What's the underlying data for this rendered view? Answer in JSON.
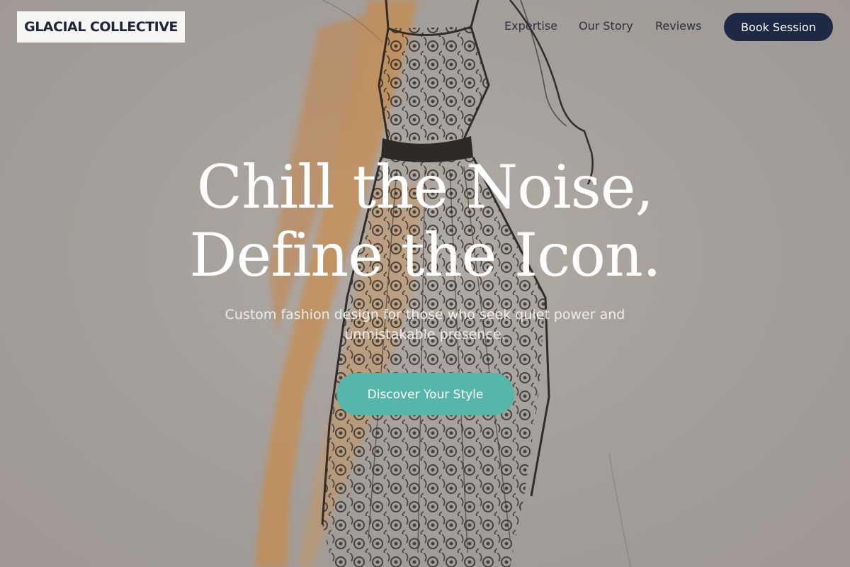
{
  "brand": {
    "name": "GLACIAL COLLECTIVE"
  },
  "nav": {
    "links": [
      {
        "label": "Expertise"
      },
      {
        "label": "Our Story"
      },
      {
        "label": "Reviews"
      }
    ],
    "cta_label": "Book Session"
  },
  "hero": {
    "headline_line1": "Chill the Noise,",
    "headline_line2": "Define the Icon.",
    "subtitle": "Custom fashion design for those who seek quiet power and unmistakable presence.",
    "cta_label": "Discover Your Style",
    "background_image": "fashion-sketch-dress-illustration"
  },
  "colors": {
    "primary_navy": "#1e2a45",
    "accent_teal": "#55b6a9",
    "logo_bg": "#f5f5f4",
    "sketch_orange": "#d89a52"
  }
}
